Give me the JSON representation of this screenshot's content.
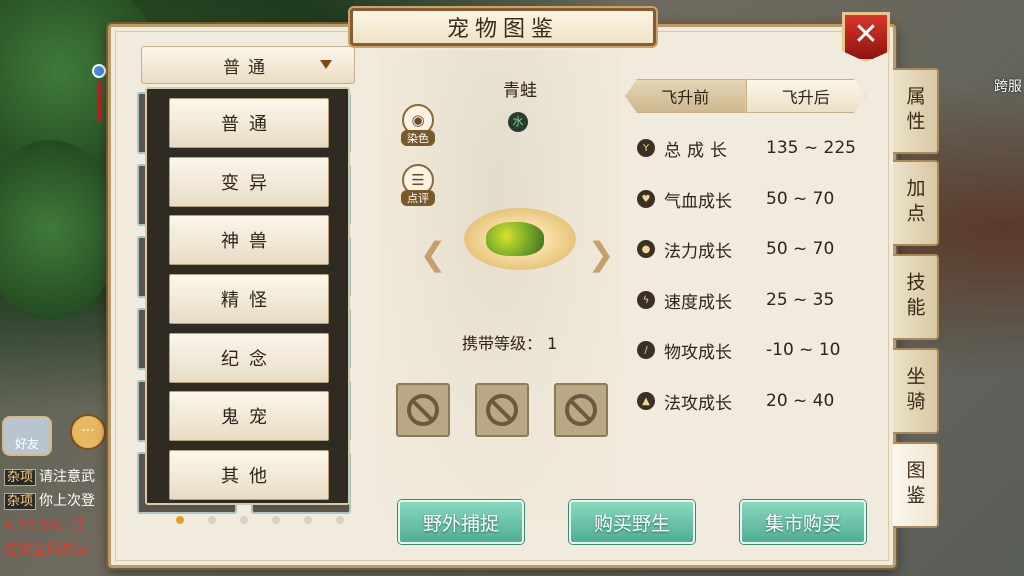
{
  "window": {
    "title": "宠物图鉴",
    "close_symbol": "✕"
  },
  "category_dropdown": {
    "selected": "普通"
  },
  "category_menu": [
    {
      "label": "普通"
    },
    {
      "label": "变异"
    },
    {
      "label": "神兽"
    },
    {
      "label": "精怪"
    },
    {
      "label": "纪念"
    },
    {
      "label": "鬼宠"
    },
    {
      "label": "其他"
    }
  ],
  "pager": {
    "pages": 6,
    "active": 0
  },
  "pet": {
    "name": "青蛙",
    "element": "水",
    "carry_level_label": "携带等级：",
    "carry_level": "1",
    "dye_label": "染色",
    "review_label": "点评",
    "prev_arrow": "❮",
    "next_arrow": "❯"
  },
  "ascension_tabs": [
    {
      "label": "飞升前",
      "active": true
    },
    {
      "label": "飞升后",
      "active": false
    }
  ],
  "stats": [
    {
      "label": "总成长",
      "value": "135 ~ 225",
      "icon": "growth-icon",
      "glyph": "Y",
      "spaced": true
    },
    {
      "label": "气血成长",
      "value": "50 ~ 70",
      "icon": "heart-icon",
      "glyph": "♥",
      "spaced": false
    },
    {
      "label": "法力成长",
      "value": "50 ~ 70",
      "icon": "mana-drop-icon",
      "glyph": "●",
      "spaced": false
    },
    {
      "label": "速度成长",
      "value": "25 ~ 35",
      "icon": "speed-bolt-icon",
      "glyph": "ϟ",
      "spaced": false
    },
    {
      "label": "物攻成长",
      "value": "-10 ~ 10",
      "icon": "sword-icon",
      "glyph": "/",
      "spaced": false
    },
    {
      "label": "法攻成长",
      "value": "20 ~ 40",
      "icon": "flame-icon",
      "glyph": "▲",
      "spaced": false
    }
  ],
  "actions": {
    "wild_capture": "野外捕捉",
    "buy_wild": "购买野生",
    "market_buy": "集市购买"
  },
  "side_tabs": [
    {
      "label": "属性",
      "active": false
    },
    {
      "label": "加点",
      "active": false
    },
    {
      "label": "技能",
      "active": false
    },
    {
      "label": "坐骑",
      "active": false
    },
    {
      "label": "图鉴",
      "active": true
    }
  ],
  "chat": {
    "friend_label": "好友",
    "lines": [
      {
        "tag": "杂项",
        "text": "请注意武"
      },
      {
        "tag": "杂项",
        "text": "你上次登"
      }
    ],
    "red_line_1": "4:23:00。注",
    "red_line_2": "定安全码验证"
  },
  "edge_text": "跨服"
}
